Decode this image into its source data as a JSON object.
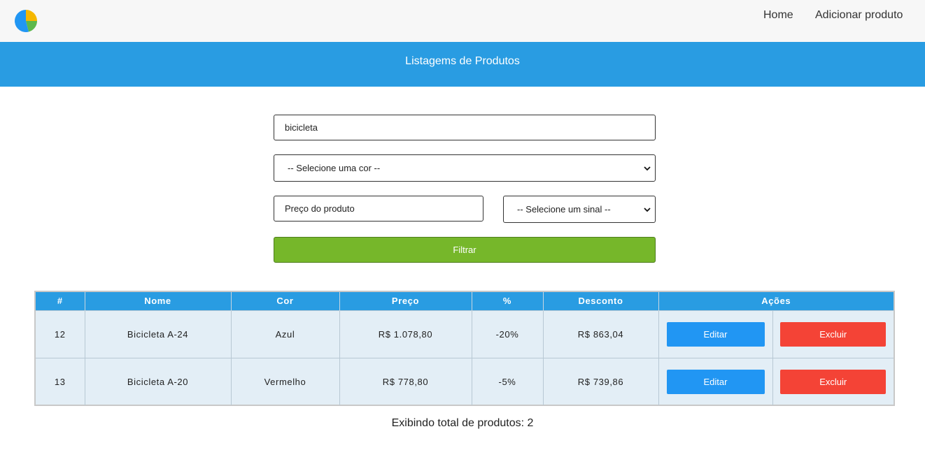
{
  "nav": {
    "home": "Home",
    "add_product": "Adicionar produto"
  },
  "header": {
    "title": "Listagems de Produtos"
  },
  "filters": {
    "search_value": "bicicleta",
    "color_select": "-- Selecione uma cor --",
    "price_placeholder": "Preço do produto",
    "sign_select": "-- Selecione um sinal --",
    "filter_button": "Filtrar"
  },
  "table": {
    "columns": [
      "#",
      "Nome",
      "Cor",
      "Preço",
      "%",
      "Desconto",
      "Ações"
    ],
    "rows": [
      {
        "id": "12",
        "name": "Bicicleta A-24",
        "color": "Azul",
        "price": "R$ 1.078,80",
        "percent": "-20%",
        "discount": "R$ 863,04",
        "edit": "Editar",
        "delete": "Excluir"
      },
      {
        "id": "13",
        "name": "Bicicleta A-20",
        "color": "Vermelho",
        "price": "R$ 778,80",
        "percent": "-5%",
        "discount": "R$ 739,86",
        "edit": "Editar",
        "delete": "Excluir"
      }
    ]
  },
  "footer": {
    "total": "Exibindo total de produtos: 2"
  },
  "colors": {
    "primary": "#299ce2",
    "filter": "#76b72a",
    "edit": "#2196f3",
    "delete": "#f44336"
  },
  "icons": {
    "logo": "pie-chart-icon",
    "select": "chevron-down-icon"
  }
}
